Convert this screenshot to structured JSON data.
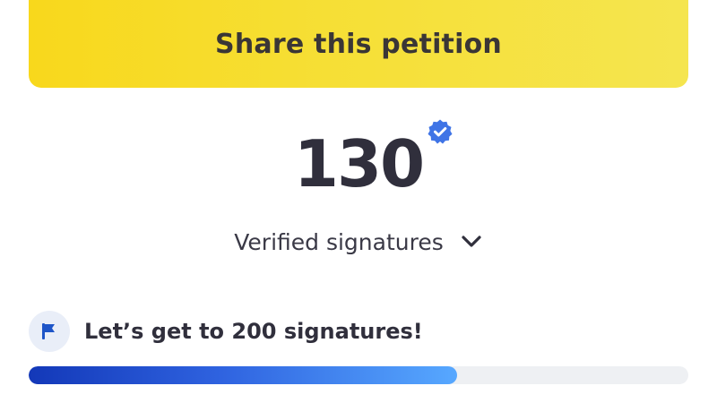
{
  "share": {
    "label": "Share this petition",
    "color": "#f8d81c"
  },
  "signatures": {
    "count": "130",
    "label": "Verified signatures",
    "verified_icon": "verified-badge-icon",
    "toggle_icon": "chevron-down-icon"
  },
  "goal": {
    "text": "Let’s get to 200 signatures!",
    "icon": "flag-icon",
    "progress_fraction": 0.65,
    "progress_color": "#1f4fd6"
  }
}
